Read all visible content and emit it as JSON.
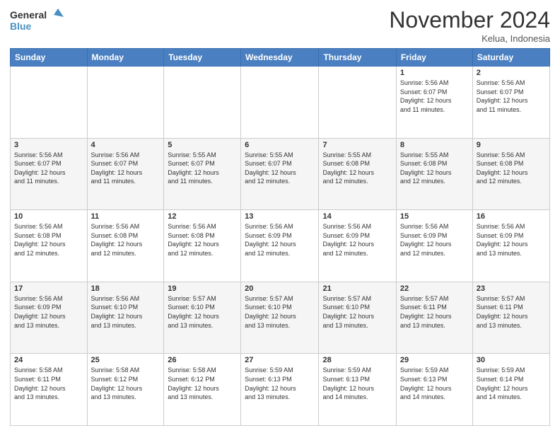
{
  "header": {
    "logo_line1": "General",
    "logo_line2": "Blue",
    "month": "November 2024",
    "location": "Kelua, Indonesia"
  },
  "days_of_week": [
    "Sunday",
    "Monday",
    "Tuesday",
    "Wednesday",
    "Thursday",
    "Friday",
    "Saturday"
  ],
  "weeks": [
    [
      {
        "day": "",
        "info": ""
      },
      {
        "day": "",
        "info": ""
      },
      {
        "day": "",
        "info": ""
      },
      {
        "day": "",
        "info": ""
      },
      {
        "day": "",
        "info": ""
      },
      {
        "day": "1",
        "info": "Sunrise: 5:56 AM\nSunset: 6:07 PM\nDaylight: 12 hours\nand 11 minutes."
      },
      {
        "day": "2",
        "info": "Sunrise: 5:56 AM\nSunset: 6:07 PM\nDaylight: 12 hours\nand 11 minutes."
      }
    ],
    [
      {
        "day": "3",
        "info": "Sunrise: 5:56 AM\nSunset: 6:07 PM\nDaylight: 12 hours\nand 11 minutes."
      },
      {
        "day": "4",
        "info": "Sunrise: 5:56 AM\nSunset: 6:07 PM\nDaylight: 12 hours\nand 11 minutes."
      },
      {
        "day": "5",
        "info": "Sunrise: 5:55 AM\nSunset: 6:07 PM\nDaylight: 12 hours\nand 11 minutes."
      },
      {
        "day": "6",
        "info": "Sunrise: 5:55 AM\nSunset: 6:07 PM\nDaylight: 12 hours\nand 12 minutes."
      },
      {
        "day": "7",
        "info": "Sunrise: 5:55 AM\nSunset: 6:08 PM\nDaylight: 12 hours\nand 12 minutes."
      },
      {
        "day": "8",
        "info": "Sunrise: 5:55 AM\nSunset: 6:08 PM\nDaylight: 12 hours\nand 12 minutes."
      },
      {
        "day": "9",
        "info": "Sunrise: 5:56 AM\nSunset: 6:08 PM\nDaylight: 12 hours\nand 12 minutes."
      }
    ],
    [
      {
        "day": "10",
        "info": "Sunrise: 5:56 AM\nSunset: 6:08 PM\nDaylight: 12 hours\nand 12 minutes."
      },
      {
        "day": "11",
        "info": "Sunrise: 5:56 AM\nSunset: 6:08 PM\nDaylight: 12 hours\nand 12 minutes."
      },
      {
        "day": "12",
        "info": "Sunrise: 5:56 AM\nSunset: 6:08 PM\nDaylight: 12 hours\nand 12 minutes."
      },
      {
        "day": "13",
        "info": "Sunrise: 5:56 AM\nSunset: 6:09 PM\nDaylight: 12 hours\nand 12 minutes."
      },
      {
        "day": "14",
        "info": "Sunrise: 5:56 AM\nSunset: 6:09 PM\nDaylight: 12 hours\nand 12 minutes."
      },
      {
        "day": "15",
        "info": "Sunrise: 5:56 AM\nSunset: 6:09 PM\nDaylight: 12 hours\nand 12 minutes."
      },
      {
        "day": "16",
        "info": "Sunrise: 5:56 AM\nSunset: 6:09 PM\nDaylight: 12 hours\nand 13 minutes."
      }
    ],
    [
      {
        "day": "17",
        "info": "Sunrise: 5:56 AM\nSunset: 6:09 PM\nDaylight: 12 hours\nand 13 minutes."
      },
      {
        "day": "18",
        "info": "Sunrise: 5:56 AM\nSunset: 6:10 PM\nDaylight: 12 hours\nand 13 minutes."
      },
      {
        "day": "19",
        "info": "Sunrise: 5:57 AM\nSunset: 6:10 PM\nDaylight: 12 hours\nand 13 minutes."
      },
      {
        "day": "20",
        "info": "Sunrise: 5:57 AM\nSunset: 6:10 PM\nDaylight: 12 hours\nand 13 minutes."
      },
      {
        "day": "21",
        "info": "Sunrise: 5:57 AM\nSunset: 6:10 PM\nDaylight: 12 hours\nand 13 minutes."
      },
      {
        "day": "22",
        "info": "Sunrise: 5:57 AM\nSunset: 6:11 PM\nDaylight: 12 hours\nand 13 minutes."
      },
      {
        "day": "23",
        "info": "Sunrise: 5:57 AM\nSunset: 6:11 PM\nDaylight: 12 hours\nand 13 minutes."
      }
    ],
    [
      {
        "day": "24",
        "info": "Sunrise: 5:58 AM\nSunset: 6:11 PM\nDaylight: 12 hours\nand 13 minutes."
      },
      {
        "day": "25",
        "info": "Sunrise: 5:58 AM\nSunset: 6:12 PM\nDaylight: 12 hours\nand 13 minutes."
      },
      {
        "day": "26",
        "info": "Sunrise: 5:58 AM\nSunset: 6:12 PM\nDaylight: 12 hours\nand 13 minutes."
      },
      {
        "day": "27",
        "info": "Sunrise: 5:59 AM\nSunset: 6:13 PM\nDaylight: 12 hours\nand 13 minutes."
      },
      {
        "day": "28",
        "info": "Sunrise: 5:59 AM\nSunset: 6:13 PM\nDaylight: 12 hours\nand 14 minutes."
      },
      {
        "day": "29",
        "info": "Sunrise: 5:59 AM\nSunset: 6:13 PM\nDaylight: 12 hours\nand 14 minutes."
      },
      {
        "day": "30",
        "info": "Sunrise: 5:59 AM\nSunset: 6:14 PM\nDaylight: 12 hours\nand 14 minutes."
      }
    ]
  ]
}
